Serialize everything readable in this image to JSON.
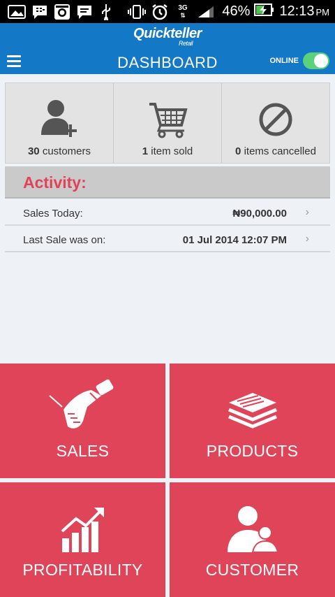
{
  "status_bar": {
    "battery": "46%",
    "time": "12:13",
    "ampm": "PM",
    "network": "3G",
    "icons": [
      "gallery-icon",
      "bbm-icon",
      "instagram-icon",
      "message-icon",
      "usb-icon",
      "vibrate-icon",
      "alarm-icon",
      "data-3g-icon",
      "signal-icon",
      "battery-charging-icon"
    ]
  },
  "app_bar": {
    "logo": "Quickteller",
    "logo_sub": "Retail",
    "title": "DASHBOARD",
    "online_label": "ONLINE",
    "online": true
  },
  "stats": [
    {
      "count": "30",
      "label": "customers",
      "icon": "add-customer-icon"
    },
    {
      "count": "1",
      "label": "item sold",
      "icon": "cart-icon"
    },
    {
      "count": "0",
      "label": "items cancelled",
      "icon": "cancel-icon"
    }
  ],
  "activity": {
    "heading": "Activity:",
    "rows": [
      {
        "label": "Sales Today:",
        "value": "₦90,000.00"
      },
      {
        "label": "Last Sale was on:",
        "value": "01 Jul 2014 12:07 PM"
      }
    ]
  },
  "tiles": [
    {
      "label": "SALES",
      "icon": "handshake-icon"
    },
    {
      "label": "PRODUCTS",
      "icon": "layers-icon"
    },
    {
      "label": "PROFITABILITY",
      "icon": "growth-chart-icon"
    },
    {
      "label": "CUSTOMER",
      "icon": "users-icon"
    }
  ],
  "colors": {
    "app_bar": "#1378c6",
    "tile": "#e04458",
    "activity_heading": "#e04358",
    "toggle_on": "#5ad17a"
  }
}
